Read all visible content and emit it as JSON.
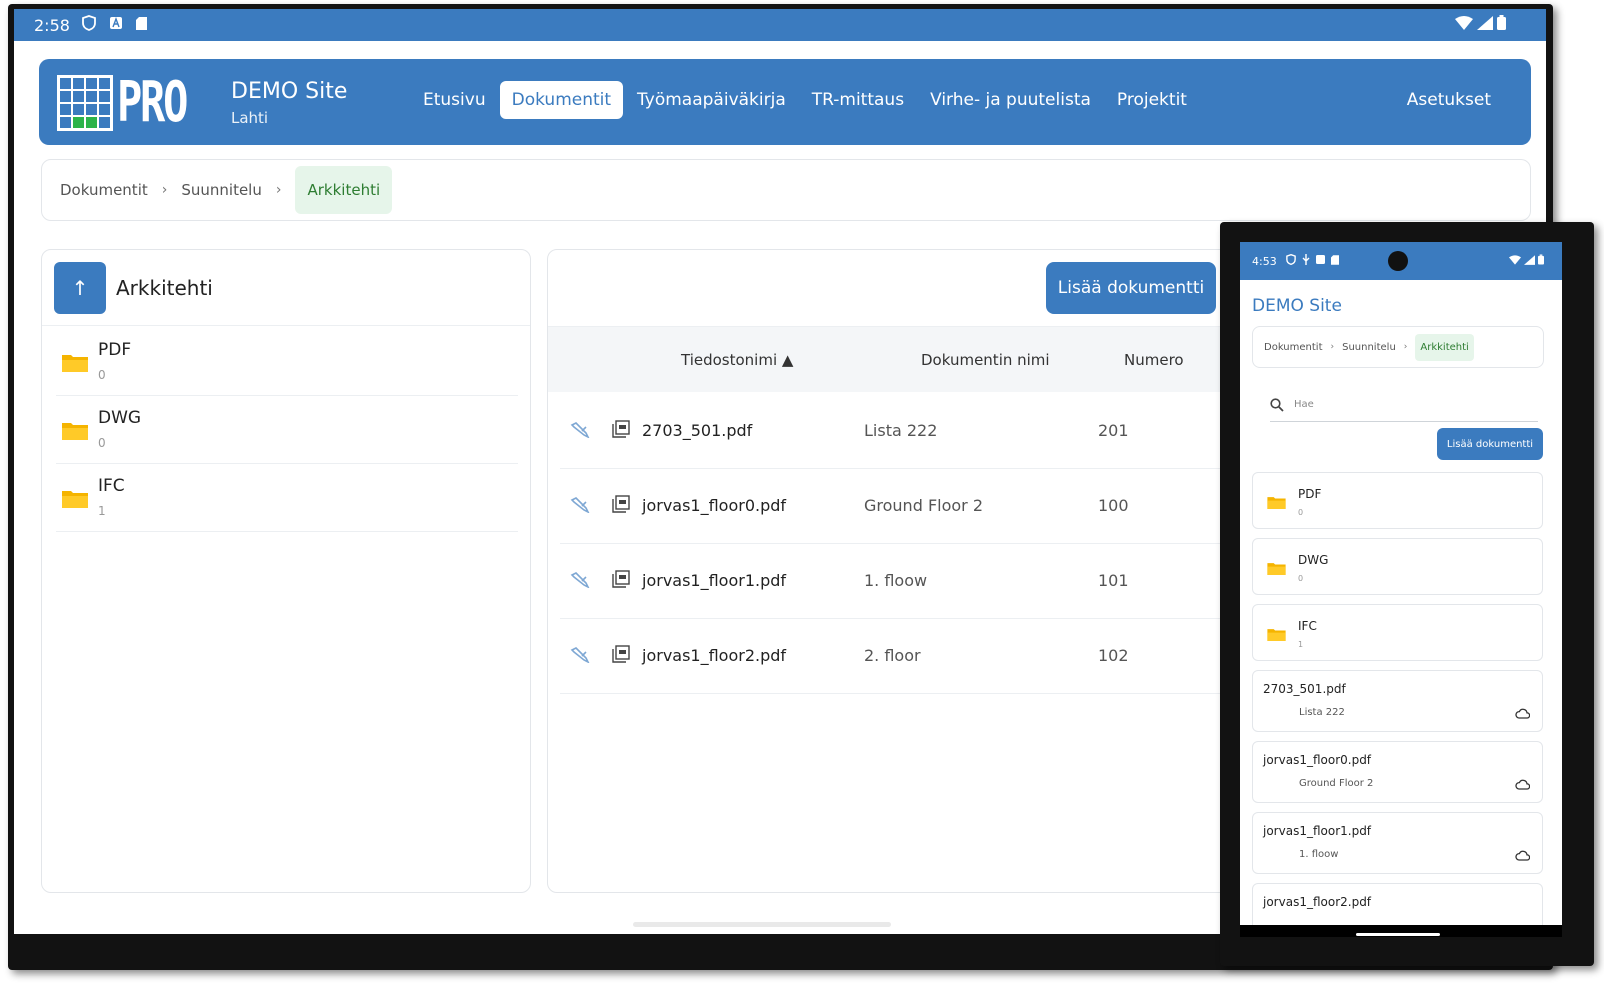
{
  "tablet": {
    "status": {
      "time": "2:58"
    },
    "app": {
      "logo_text": "PRO",
      "site_name": "DEMO Site",
      "site_city": "Lahti"
    },
    "nav": {
      "items": [
        {
          "label": "Etusivu"
        },
        {
          "label": "Dokumentit"
        },
        {
          "label": "Työmaapäiväkirja"
        },
        {
          "label": "TR-mittaus"
        },
        {
          "label": "Virhe- ja puutelista"
        },
        {
          "label": "Projektit"
        }
      ],
      "active": "Dokumentit",
      "settings": "Asetukset"
    },
    "breadcrumb": {
      "items": [
        "Dokumentit",
        "Suunnitelu",
        "Arkkitehti"
      ],
      "separator": "›"
    },
    "folder_panel": {
      "up_icon": "↑",
      "title": "Arkkitehti",
      "folders": [
        {
          "name": "PDF",
          "count": "0"
        },
        {
          "name": "DWG",
          "count": "0"
        },
        {
          "name": "IFC",
          "count": "1"
        }
      ]
    },
    "documents": {
      "add_label": "Lisää dokumentti",
      "columns": {
        "filename": "Tiedostonimi ▲",
        "docname": "Dokumentin nimi",
        "number": "Numero"
      },
      "rows": [
        {
          "file": "2703_501.pdf",
          "name": "Lista 222",
          "number": "201"
        },
        {
          "file": "jorvas1_floor0.pdf",
          "name": "Ground Floor 2",
          "number": "100"
        },
        {
          "file": "jorvas1_floor1.pdf",
          "name": "1. floow",
          "number": "101"
        },
        {
          "file": "jorvas1_floor2.pdf",
          "name": "2. floor",
          "number": "102"
        }
      ]
    }
  },
  "phone": {
    "status": {
      "time": "4:53"
    },
    "site_name": "DEMO Site",
    "breadcrumb": {
      "items": [
        "Dokumentit",
        "Suunnitelu",
        "Arkkitehti"
      ],
      "separator": "›"
    },
    "search": {
      "placeholder": "Hae"
    },
    "add_label": "Lisää dokumentti",
    "folders": [
      {
        "name": "PDF",
        "count": "0"
      },
      {
        "name": "DWG",
        "count": "0"
      },
      {
        "name": "IFC",
        "count": "1"
      }
    ],
    "documents": [
      {
        "file": "2703_501.pdf",
        "name": "Lista 222"
      },
      {
        "file": "jorvas1_floor0.pdf",
        "name": "Ground Floor 2"
      },
      {
        "file": "jorvas1_floor1.pdf",
        "name": "1. floow"
      },
      {
        "file": "jorvas1_floor2.pdf",
        "name": ""
      }
    ]
  },
  "icons": {
    "folder": "folder-icon",
    "edit": "wrench-icon",
    "pdf": "pdf-file-icon",
    "cloud": "cloud-icon",
    "search": "search-icon",
    "up": "arrow-up-icon"
  },
  "colors": {
    "brand": "#3b7bbf",
    "crumb_active_bg": "#e6f5ea",
    "crumb_active_text": "#2e7d32",
    "folder": "#f5b400"
  }
}
